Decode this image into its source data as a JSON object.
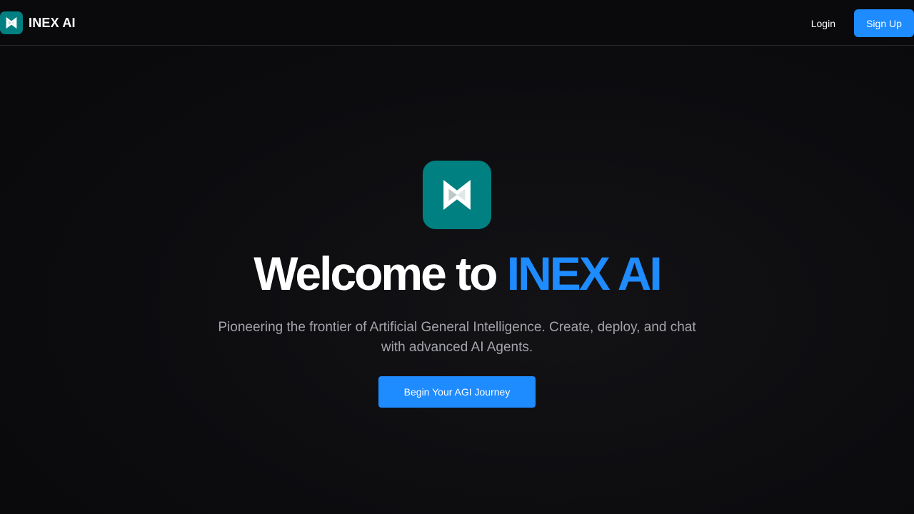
{
  "colors": {
    "accent": "#1e8bff",
    "teal": "#008080",
    "subtext": "#a3a3ab"
  },
  "header": {
    "brand_name": "INEX AI",
    "logo_icon": "inex-logo-icon",
    "login_label": "Login",
    "signup_label": "Sign Up"
  },
  "hero": {
    "logo_icon": "inex-logo-icon",
    "title_prefix": "Welcome to",
    "title_accent": "INEX AI",
    "subtitle_line1": "Pioneering the frontier of Artificial General Intelligence. Create, deploy, and chat",
    "subtitle_line2": "with advanced AI Agents.",
    "cta_label": "Begin Your AGI Journey"
  }
}
